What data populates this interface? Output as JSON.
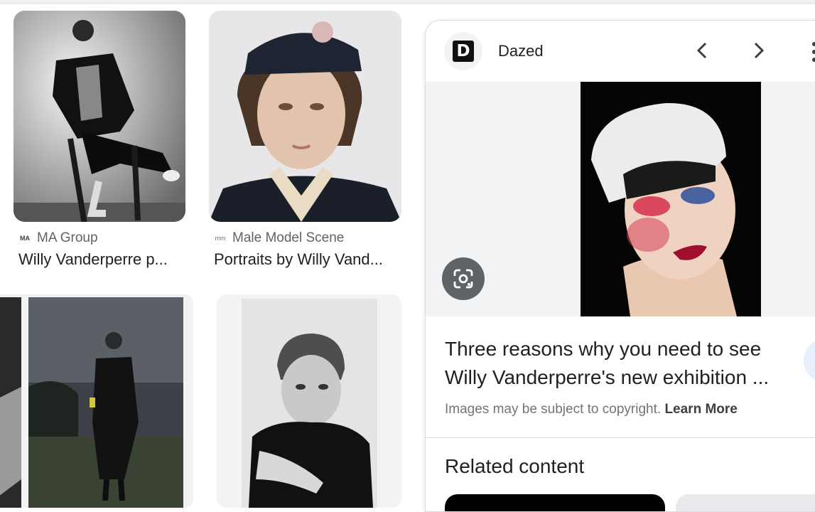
{
  "results": [
    {
      "source": "MA Group",
      "favicon": "MA",
      "title": "Willy Vanderperre p..."
    },
    {
      "source": "Male Model Scene",
      "favicon": "mm",
      "title": "Portraits by Willy Vand..."
    }
  ],
  "panel": {
    "source_name": "Dazed",
    "logo_letter": "D",
    "prev_icon": "chevron-left-icon",
    "next_icon": "chevron-right-icon",
    "lens_icon": "google-lens-icon",
    "title_line1": "Three reasons why you need to see",
    "title_line2": "Willy Vanderperre's new exhibition ...",
    "copyright_text": "Images may be subject to copyright.",
    "learn_more": "Learn More",
    "related_heading": "Related content"
  },
  "colors": {
    "text": "#202124",
    "muted": "#5f6368",
    "panel_bg": "#f1f3f4"
  }
}
